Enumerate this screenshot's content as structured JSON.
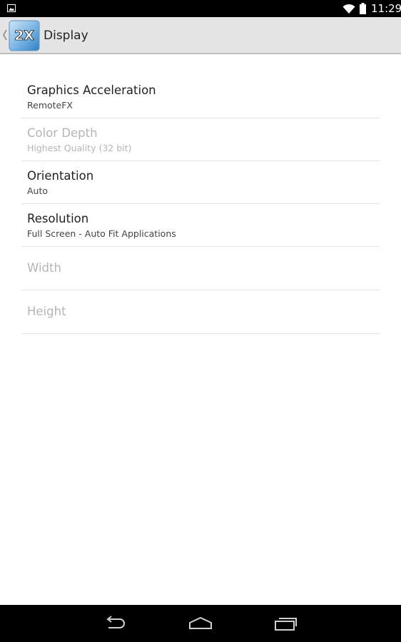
{
  "status_bar": {
    "time": "11:29",
    "icons": [
      "image-notification-icon",
      "wifi-icon",
      "battery-icon"
    ]
  },
  "action_bar": {
    "logo_text": "2X",
    "title": "Display"
  },
  "preferences": [
    {
      "title": "Graphics Acceleration",
      "summary": "RemoteFX",
      "enabled": true
    },
    {
      "title": "Color Depth",
      "summary": "Highest Quality (32 bit)",
      "enabled": false
    },
    {
      "title": "Orientation",
      "summary": "Auto",
      "enabled": true
    },
    {
      "title": "Resolution",
      "summary": "Full Screen - Auto Fit Applications",
      "enabled": true
    },
    {
      "title": "Width",
      "enabled": false
    },
    {
      "title": "Height",
      "enabled": false
    }
  ],
  "nav_bar": {
    "buttons": [
      "back-icon",
      "home-icon",
      "recents-icon"
    ]
  },
  "colors": {
    "action_bar_bg": "#e5e5e5",
    "disabled_text": "#b5b5b5",
    "logo_blue": "#2f7fc4"
  }
}
